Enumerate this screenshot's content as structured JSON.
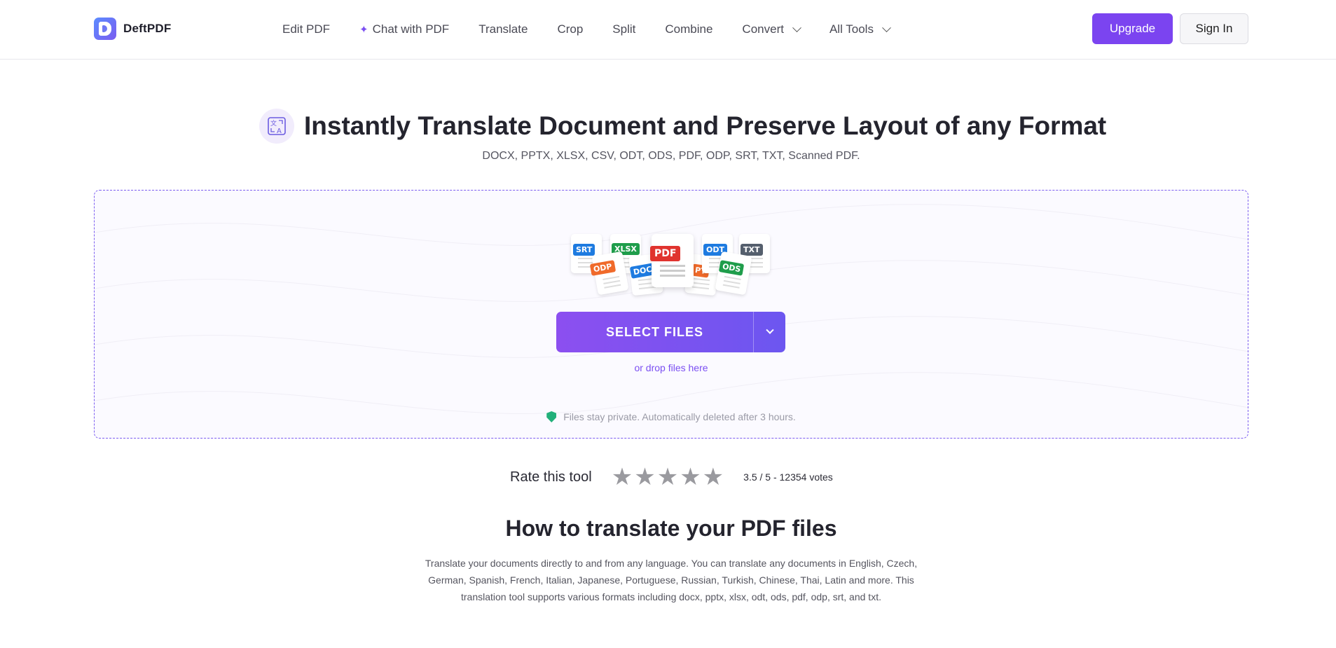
{
  "brand": {
    "name": "DeftPDF",
    "accent": "#7b44f0",
    "success": "#22b07a"
  },
  "nav": {
    "items": [
      {
        "label": "Edit PDF",
        "icon": ""
      },
      {
        "label": "Chat with PDF",
        "icon": "sparkle-icon"
      },
      {
        "label": "Translate",
        "icon": ""
      },
      {
        "label": "Crop",
        "icon": ""
      },
      {
        "label": "Split",
        "icon": ""
      },
      {
        "label": "Combine",
        "icon": ""
      },
      {
        "label": "Convert",
        "icon": "chevron-down-icon"
      },
      {
        "label": "All Tools",
        "icon": "chevron-down-icon"
      }
    ],
    "upgrade": "Upgrade",
    "sign_in": "Sign In"
  },
  "hero": {
    "title": "Instantly Translate Document and Preserve Layout of any Format",
    "subtitle": "DOCX, PPTX, XLSX, CSV, ODT, ODS, PDF, ODP, SRT, TXT, Scanned PDF."
  },
  "upload": {
    "file_tags": [
      "SRT",
      "XLSX",
      "ODP",
      "DOC",
      "PDF",
      "PT",
      "ODT",
      "TXT",
      "ODS"
    ],
    "select_files": "SELECT FILES",
    "drop_hint": "or drop files here",
    "privacy": "Files stay private. Automatically deleted after 3 hours."
  },
  "rating": {
    "label": "Rate this tool",
    "summary": "3.5 / 5 - 12354 votes"
  },
  "how": {
    "title": "How to translate your PDF files",
    "text": "Translate your documents directly to and from any language. You can translate any documents in English, Czech, German, Spanish, French, Italian, Japanese, Portuguese, Russian, Turkish, Chinese, Thai, Latin and more. This translation tool supports various formats including docx, pptx, xlsx, odt, ods, pdf, odp, srt, and txt."
  }
}
